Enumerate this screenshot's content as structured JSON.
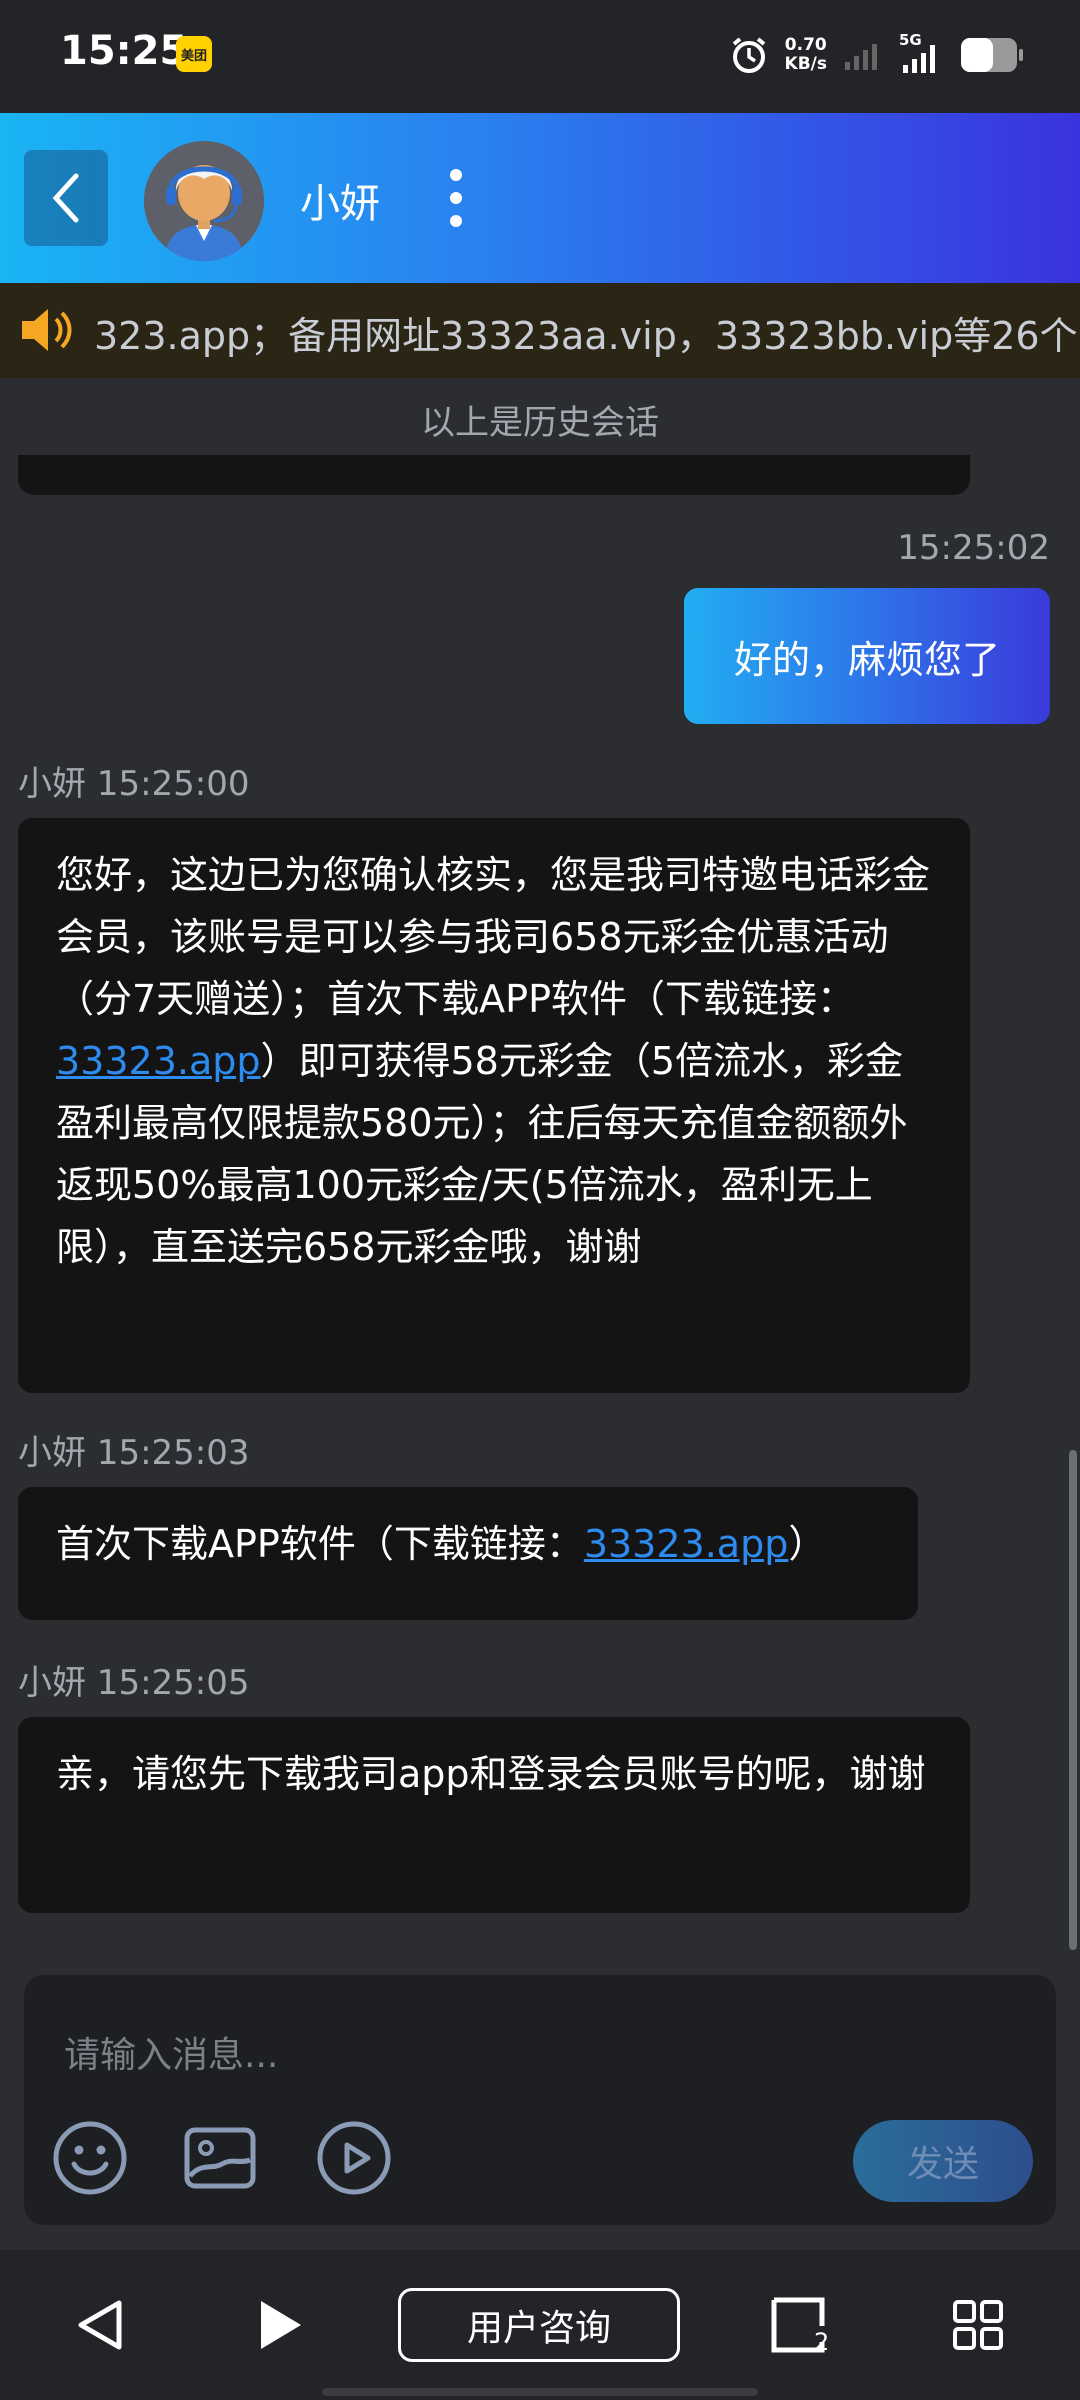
{
  "status_bar": {
    "time": "15:25",
    "app_badge": "美团",
    "net_speed_value": "0.70",
    "net_speed_unit": "KB/s",
    "network_type": "5G"
  },
  "header": {
    "agent_name": "小妍"
  },
  "notice": {
    "text": "323.app；备用网址33323aa.vip，33323bb.vip等26个"
  },
  "chat": {
    "history_label": "以上是历史会话",
    "self_time": "15:25:02",
    "self_message": "好的，麻烦您了",
    "messages": [
      {
        "meta": "小妍 15:25:00",
        "text_before": "您好，这边已为您确认核实，您是我司特邀电话彩金会员，该账号是可以参与我司658元彩金优惠活动（分7天赠送）；首次下载APP软件（下载链接：",
        "link": "33323.app",
        "text_after": "）即可获得58元彩金（5倍流水，彩金盈利最高仅限提款580元）；往后每天充值金额额外返现50%最高100元彩金/天(5倍流水，盈利无上限），直至送完658元彩金哦，谢谢"
      },
      {
        "meta": "小妍 15:25:03",
        "text_before": "首次下载APP软件（下载链接：",
        "link": "33323.app",
        "text_after": "）"
      },
      {
        "meta": "小妍 15:25:05",
        "text": "亲，请您先下载我司app和登录会员账号的呢，谢谢"
      }
    ]
  },
  "composer": {
    "placeholder": "请输入消息...",
    "send_label": "发送"
  },
  "nav": {
    "consult_label": "用户咨询",
    "tabs_count": "2"
  },
  "colors": {
    "header_gradient_start": "#1ab4f4",
    "header_gradient_end": "#3a33de",
    "link": "#2d8cf0",
    "bubble_bg": "#141414",
    "page_bg": "#2b2d30"
  }
}
